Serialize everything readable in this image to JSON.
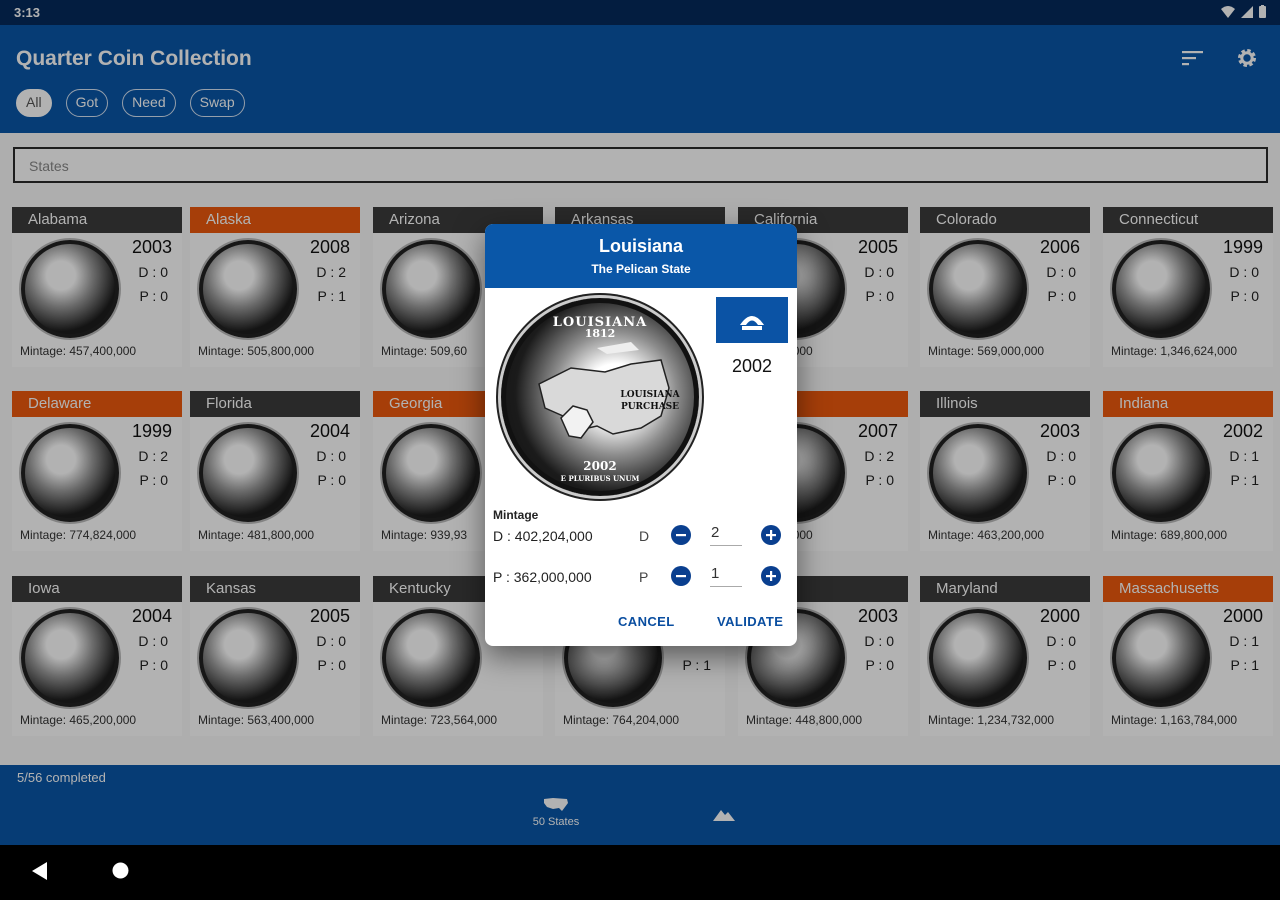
{
  "status_bar": {
    "time": "3:13"
  },
  "app": {
    "title": "Quarter Coin Collection",
    "icons": [
      "sort-icon",
      "settings-gear-icon"
    ],
    "filters": [
      {
        "label": "All",
        "active": true
      },
      {
        "label": "Got",
        "active": false
      },
      {
        "label": "Need",
        "active": false
      },
      {
        "label": "Swap",
        "active": false
      }
    ]
  },
  "search": {
    "placeholder": "States"
  },
  "cards": [
    {
      "name": "Alabama",
      "owned": false,
      "year": "2003",
      "d": "D : 0",
      "p": "P : 0",
      "mintage": "Mintage: 457,400,000"
    },
    {
      "name": "Alaska",
      "owned": true,
      "year": "2008",
      "d": "D : 2",
      "p": "P : 1",
      "mintage": "Mintage: 505,800,000"
    },
    {
      "name": "Arizona",
      "owned": false,
      "year": "",
      "d": "",
      "p": "",
      "mintage": "Mintage: 509,60"
    },
    {
      "name": "Arkansas",
      "owned": false,
      "year": "",
      "d": "",
      "p": "",
      "mintage": ""
    },
    {
      "name": "California",
      "owned": false,
      "year": "2005",
      "d": "D : 0",
      "p": "P : 0",
      "mintage": "520,400,000"
    },
    {
      "name": "Colorado",
      "owned": false,
      "year": "2006",
      "d": "D : 0",
      "p": "P : 0",
      "mintage": "Mintage: 569,000,000"
    },
    {
      "name": "Connecticut",
      "owned": false,
      "year": "1999",
      "d": "D : 0",
      "p": "P : 0",
      "mintage": "Mintage: 1,346,624,000"
    },
    {
      "name": "Delaware",
      "owned": true,
      "year": "1999",
      "d": "D : 2",
      "p": "P : 0",
      "mintage": "Mintage: 774,824,000"
    },
    {
      "name": "Florida",
      "owned": false,
      "year": "2004",
      "d": "D : 0",
      "p": "P : 0",
      "mintage": "Mintage: 481,800,000"
    },
    {
      "name": "Georgia",
      "owned": true,
      "year": "",
      "d": "",
      "p": "",
      "mintage": "Mintage: 939,93"
    },
    {
      "name": "",
      "owned": false,
      "year": "",
      "d": "",
      "p": "",
      "mintage": ""
    },
    {
      "name": "",
      "owned": true,
      "year": "2007",
      "d": "D : 2",
      "p": "P : 0",
      "mintage": "581,400,000"
    },
    {
      "name": "Illinois",
      "owned": false,
      "year": "2003",
      "d": "D : 0",
      "p": "P : 0",
      "mintage": "Mintage: 463,200,000"
    },
    {
      "name": "Indiana",
      "owned": true,
      "year": "2002",
      "d": "D : 1",
      "p": "P : 1",
      "mintage": "Mintage: 689,800,000"
    },
    {
      "name": "Iowa",
      "owned": false,
      "year": "2004",
      "d": "D : 0",
      "p": "P : 0",
      "mintage": "Mintage: 465,200,000"
    },
    {
      "name": "Kansas",
      "owned": false,
      "year": "2005",
      "d": "D : 0",
      "p": "P : 0",
      "mintage": "Mintage: 563,400,000"
    },
    {
      "name": "Kentucky",
      "owned": false,
      "year": "",
      "d": "",
      "p": "",
      "mintage": "Mintage: 723,564,000"
    },
    {
      "name": "",
      "owned": false,
      "year": "",
      "d": "",
      "p": "P : 1",
      "mintage": "Mintage: 764,204,000"
    },
    {
      "name": "",
      "owned": false,
      "year": "2003",
      "d": "D : 0",
      "p": "P : 0",
      "mintage": "Mintage: 448,800,000"
    },
    {
      "name": "Maryland",
      "owned": false,
      "year": "2000",
      "d": "D : 0",
      "p": "P : 0",
      "mintage": "Mintage: 1,234,732,000"
    },
    {
      "name": "Massachusetts",
      "owned": true,
      "year": "2000",
      "d": "D : 1",
      "p": "P : 1",
      "mintage": "Mintage: 1,163,784,000"
    }
  ],
  "progress": "5/56 completed",
  "bottom_nav": {
    "states_label": "50 States"
  },
  "dialog": {
    "title": "Louisiana",
    "subtitle": "The Pelican State",
    "coin_top": "LOUISIANA",
    "coin_year_top": "1812",
    "coin_purchase": "LOUISIANA PURCHASE",
    "coin_year": "2002",
    "coin_motto": "E PLURIBUS UNUM",
    "year": "2002",
    "mintage_label": "Mintage",
    "mintage_d": "D : 402,204,000",
    "mintage_p": "P : 362,000,000",
    "d_letter": "D",
    "p_letter": "P",
    "d_qty": "2",
    "p_qty": "1",
    "cancel": "CANCEL",
    "validate": "VALIDATE"
  }
}
